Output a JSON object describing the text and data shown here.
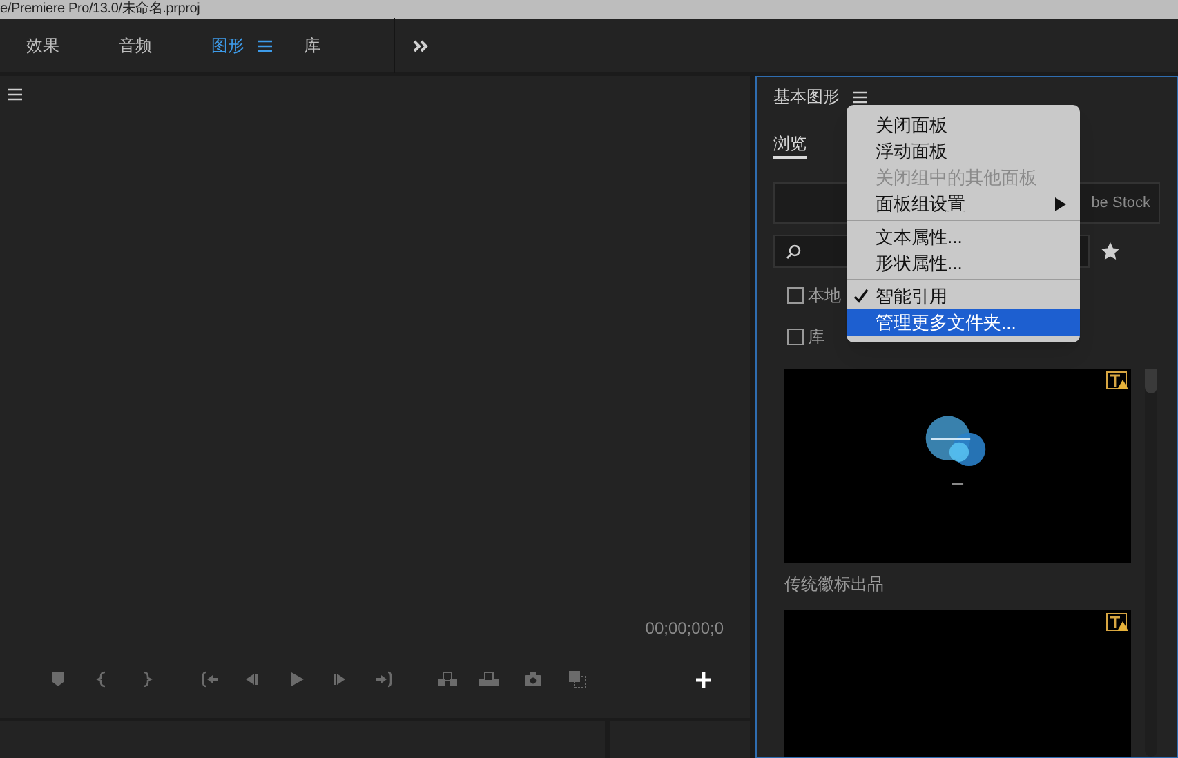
{
  "window": {
    "title": "e/Premiere Pro/13.0/未命名.prproj"
  },
  "tabs": [
    {
      "label": "效果",
      "selected": false
    },
    {
      "label": "音频",
      "selected": false
    },
    {
      "label": "图形",
      "selected": true
    },
    {
      "label": "库",
      "selected": false
    }
  ],
  "program_monitor": {
    "timecode": "00;00;00;0"
  },
  "essential_graphics": {
    "title": "基本图形",
    "tabs": [
      {
        "label": "浏览",
        "selected": true
      }
    ],
    "source_toggle": "be Stock",
    "filters": [
      {
        "label": "本地",
        "checked": false
      },
      {
        "label": "库",
        "checked": false
      }
    ],
    "templates": [
      {
        "kind": "logo",
        "name": "传统徽标出品"
      },
      {
        "kind": "blank"
      }
    ]
  },
  "context_menu": {
    "groups": [
      [
        {
          "label": "关闭面板",
          "disabled": false,
          "checked": false,
          "selected": false,
          "submenu": false
        },
        {
          "label": "浮动面板",
          "disabled": false,
          "checked": false,
          "selected": false,
          "submenu": false
        },
        {
          "label": "关闭组中的其他面板",
          "disabled": true,
          "checked": false,
          "selected": false,
          "submenu": false
        },
        {
          "label": "面板组设置",
          "disabled": false,
          "checked": false,
          "selected": false,
          "submenu": true
        }
      ],
      [
        {
          "label": "文本属性...",
          "disabled": false,
          "checked": false,
          "selected": false,
          "submenu": false
        },
        {
          "label": "形状属性...",
          "disabled": false,
          "checked": false,
          "selected": false,
          "submenu": false
        }
      ],
      [
        {
          "label": "智能引用",
          "disabled": false,
          "checked": true,
          "selected": false,
          "submenu": false
        },
        {
          "label": "管理更多文件夹...",
          "disabled": false,
          "checked": false,
          "selected": true,
          "submenu": false
        }
      ]
    ]
  }
}
